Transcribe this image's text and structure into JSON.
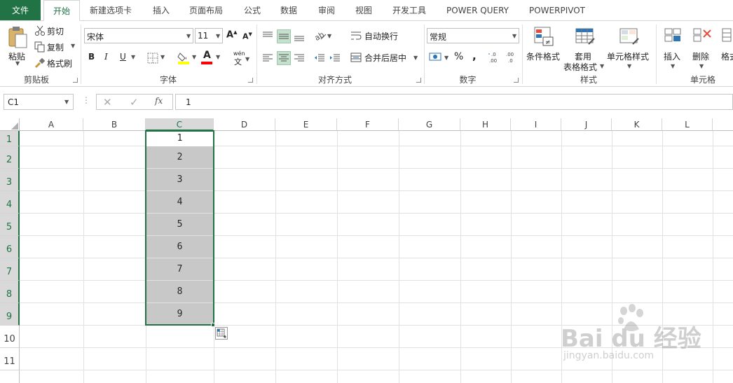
{
  "tabs": [
    "文件",
    "开始",
    "新建选项卡",
    "插入",
    "页面布局",
    "公式",
    "数据",
    "审阅",
    "视图",
    "开发工具",
    "POWER QUERY",
    "POWERPIVOT"
  ],
  "clipboard": {
    "paste": "粘贴",
    "cut": "剪切",
    "copy": "复制",
    "format_painter": "格式刷",
    "label": "剪贴板"
  },
  "font": {
    "name": "宋体",
    "size": "11",
    "label": "字体",
    "bold": "B",
    "italic": "I",
    "underline": "U",
    "font_color": "A",
    "wen": "wén",
    "wen_char": "文"
  },
  "alignment": {
    "wrap": "自动换行",
    "merge": "合并后居中",
    "label": "对齐方式"
  },
  "number": {
    "format": "常规",
    "label": "数字",
    "percent": "%",
    "comma": ","
  },
  "styles": {
    "conditional": "条件格式",
    "table_line1": "套用",
    "table_line2": "表格格式",
    "cell_styles": "单元格样式",
    "label": "样式"
  },
  "cells": {
    "insert": "插入",
    "delete": "删除",
    "format": "格式",
    "label": "单元格"
  },
  "formula_bar": {
    "name_box": "C1",
    "fx": "fx",
    "value": "1"
  },
  "columns": [
    "A",
    "B",
    "C",
    "D",
    "E",
    "F",
    "G",
    "H",
    "I",
    "J",
    "K",
    "L"
  ],
  "rows": [
    "1",
    "2",
    "3",
    "4",
    "5",
    "6",
    "7",
    "8",
    "9",
    "10",
    "11"
  ],
  "column_c_values": [
    "1",
    "2",
    "3",
    "4",
    "5",
    "6",
    "7",
    "8",
    "9"
  ],
  "colors": {
    "accent": "#217346",
    "selection_fill": "#c8c8c8"
  },
  "watermark": {
    "brand": "Bai du 经验",
    "url": "jingyan.baidu.com"
  }
}
